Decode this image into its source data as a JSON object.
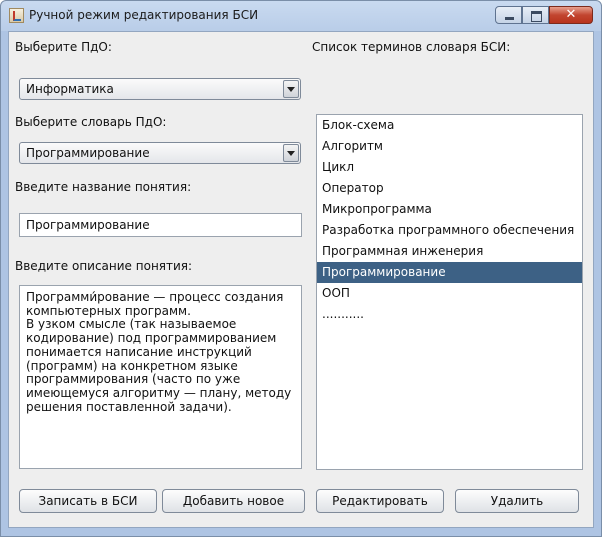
{
  "window": {
    "title": "Ручной режим редактирования БСИ"
  },
  "left": {
    "pdo_label": "Выберите ПдО:",
    "pdo_selected": "Информатика",
    "dict_label": "Выберите словарь ПдО:",
    "dict_selected": "Программирование",
    "name_label": "Введите название понятия:",
    "name_value": "Программирование",
    "desc_label": "Введите описание понятия:",
    "desc_value": "Программи́рование — процесс создания компьютерных программ.\nВ узком смысле (так называемое кодирование) под программированием понимается написание инструкций (программ) на конкретном языке программирования (часто по уже имеющемуся алгоритму — плану, методу решения поставленной задачи)."
  },
  "right": {
    "list_label": "Список терминов словаря БСИ:",
    "terms": [
      "Блок-схема",
      "Алгоритм",
      "Цикл",
      "Оператор",
      "Микропрограмма",
      "Разработка программного обеспечения",
      "Программная инженерия",
      "Программирование",
      "ООП",
      "..........."
    ],
    "selected_index": 7
  },
  "buttons": {
    "save": "Записать в БСИ",
    "add": "Добавить новое",
    "edit": "Редактировать",
    "delete": "Удалить"
  },
  "colors": {
    "selection": "#3d6185",
    "close_button": "#c24530"
  }
}
